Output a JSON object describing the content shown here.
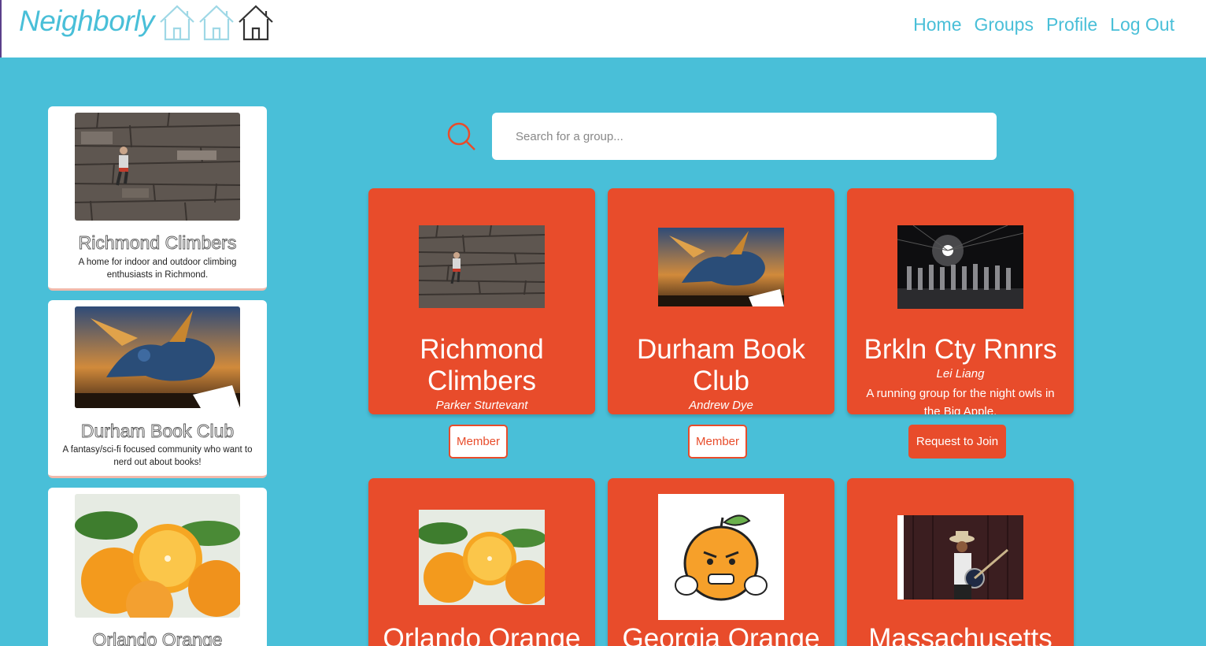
{
  "app": {
    "title": "Neighborly",
    "nav": [
      "Home",
      "Groups",
      "Profile",
      "Log Out"
    ]
  },
  "colors": {
    "accent": "#49bfd8",
    "card": "#e84c2b",
    "header_bg": "#ffffff"
  },
  "search": {
    "placeholder": "Search for a group..."
  },
  "sidebar": {
    "items": [
      {
        "name": "Richmond Climbers",
        "description": "A home for indoor and outdoor climbing enthusiasts in Richmond."
      },
      {
        "name": "Durham Book Club",
        "description": "A fantasy/sci-fi focused community who want to nerd out about books!"
      },
      {
        "name": "Orlando Orange",
        "description": ""
      }
    ]
  },
  "groups": [
    {
      "title": "Richmond Climbers",
      "owner": "Parker Sturtevant",
      "description": "",
      "button": "Member"
    },
    {
      "title": "Durham Book Club",
      "owner": "Andrew Dye",
      "description": "",
      "button": "Member"
    },
    {
      "title": "Brkln Cty Rnnrs",
      "owner": "Lei Liang",
      "description": "A running group for the night owls in the Big Apple.",
      "button": "Request to Join"
    },
    {
      "title": "Orlando Orange",
      "owner": "",
      "description": "",
      "button": ""
    },
    {
      "title": "Georgia Orange",
      "owner": "",
      "description": "",
      "button": ""
    },
    {
      "title": "Massachusetts",
      "owner": "",
      "description": "",
      "button": ""
    }
  ]
}
